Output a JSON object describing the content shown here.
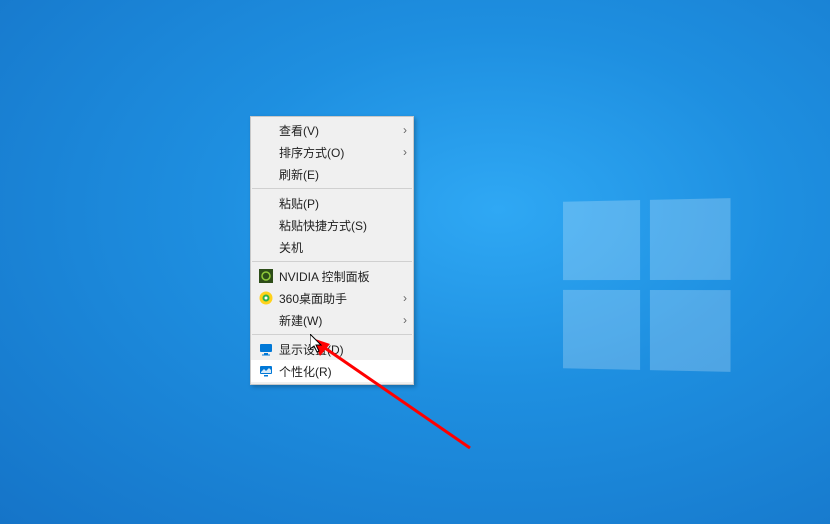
{
  "context_menu": {
    "groups": [
      [
        {
          "label": "查看(V)",
          "submenu": true,
          "icon": null
        },
        {
          "label": "排序方式(O)",
          "submenu": true,
          "icon": null
        },
        {
          "label": "刷新(E)",
          "submenu": false,
          "icon": null
        }
      ],
      [
        {
          "label": "粘贴(P)",
          "submenu": false,
          "icon": null
        },
        {
          "label": "粘贴快捷方式(S)",
          "submenu": false,
          "icon": null
        },
        {
          "label": "关机",
          "submenu": false,
          "icon": null
        }
      ],
      [
        {
          "label": "NVIDIA 控制面板",
          "submenu": false,
          "icon": "nvidia"
        },
        {
          "label": "360桌面助手",
          "submenu": true,
          "icon": "360"
        },
        {
          "label": "新建(W)",
          "submenu": true,
          "icon": null
        }
      ],
      [
        {
          "label": "显示设置(D)",
          "submenu": false,
          "icon": "display"
        },
        {
          "label": "个性化(R)",
          "submenu": false,
          "icon": "personalize",
          "hovered": true
        }
      ]
    ]
  },
  "icons": {
    "nvidia": {
      "bg": "#3a5a1e",
      "fg": "#76b900"
    },
    "360": {
      "bg": "#ffcc00",
      "fg": "#2ea44f"
    },
    "display": {
      "bg": "#0078d7"
    },
    "personalize": {
      "bg": "#0078d7"
    }
  }
}
